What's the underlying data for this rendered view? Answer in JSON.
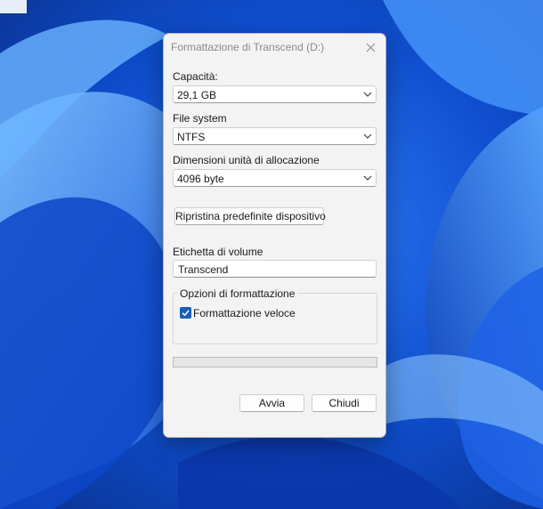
{
  "dialog": {
    "title": "Formattazione di Transcend (D:)",
    "capacity": {
      "label": "Capacità:",
      "value": "29,1 GB"
    },
    "file_system": {
      "label": "File system",
      "value": "NTFS"
    },
    "allocation": {
      "label": "Dimensioni unità di allocazione",
      "value": "4096 byte"
    },
    "restore_defaults_label": "Ripristina predefinite dispositivo",
    "volume_label": {
      "label": "Etichetta di volume",
      "value": "Transcend"
    },
    "format_options": {
      "legend": "Opzioni di formattazione",
      "quick_format": {
        "label": "Formattazione veloce",
        "checked": true
      }
    },
    "progress": 0,
    "start_label": "Avvia",
    "close_label": "Chiudi"
  },
  "colors": {
    "accent": "#1a5fb4",
    "wallpaper_base": "#0a3fb0",
    "dialog_bg": "#f3f3f3"
  },
  "icons": {
    "close": "close-icon",
    "dropdown": "chevron-down-icon",
    "check": "check-icon"
  }
}
